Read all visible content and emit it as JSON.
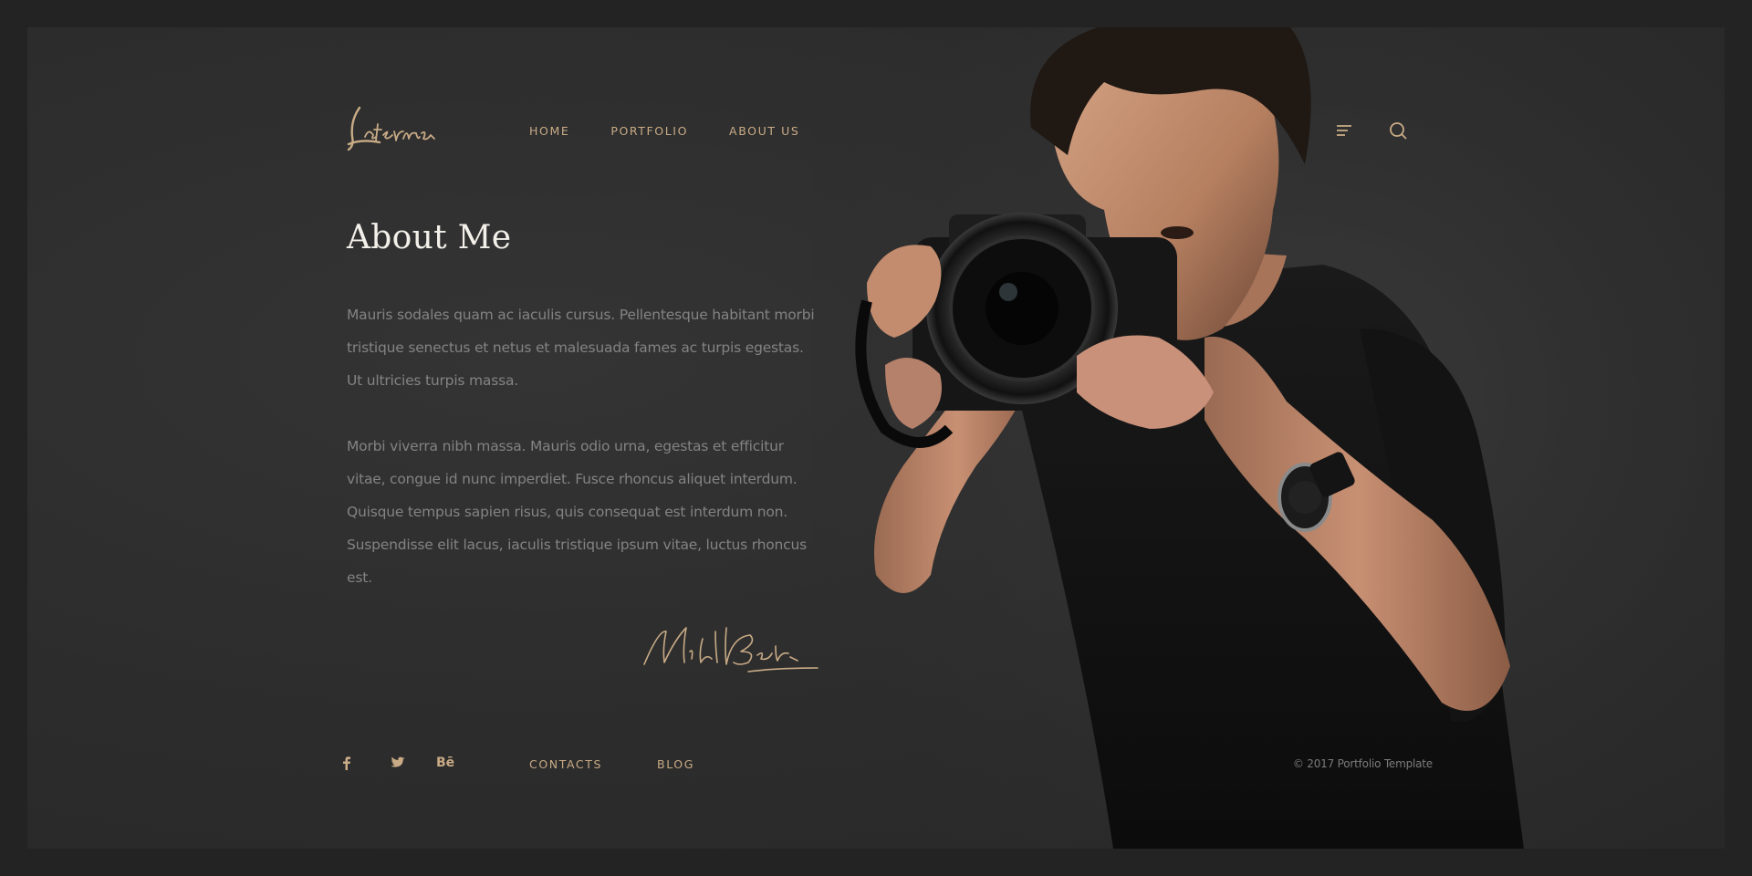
{
  "brand": {
    "logo_text": "Laterna",
    "accent": "#c9ab86"
  },
  "nav": {
    "items": [
      {
        "label": "HOME"
      },
      {
        "label": "PORTFOLIO"
      },
      {
        "label": "ABOUT US"
      }
    ],
    "menu_icon": "hamburger-menu-icon",
    "search_icon": "search-icon"
  },
  "main": {
    "title": "About Me",
    "paragraphs": [
      "Mauris sodales quam ac iaculis cursus. Pellentesque habitant morbi tristique senectus et netus et malesuada fames ac turpis egestas. Ut ultricies turpis massa.",
      "Morbi viverra nibh massa. Mauris odio urna, egestas et efficitur vitae, congue id nunc imperdiet. Fusce rhoncus aliquet interdum. Quisque tempus sapien risus, quis consequat est interdum non. Suspendisse elit lacus, iaculis tristique ipsum vitae, luctus rhoncus est."
    ],
    "signature_text": "Nick Bolton"
  },
  "footer": {
    "social": [
      {
        "icon": "facebook-icon"
      },
      {
        "icon": "twitter-icon"
      },
      {
        "icon": "behance-icon",
        "label": "Bē"
      }
    ],
    "links": [
      {
        "label": "CONTACTS"
      },
      {
        "label": "BLOG"
      }
    ],
    "copyright": "© 2017 Portfolio Template"
  }
}
